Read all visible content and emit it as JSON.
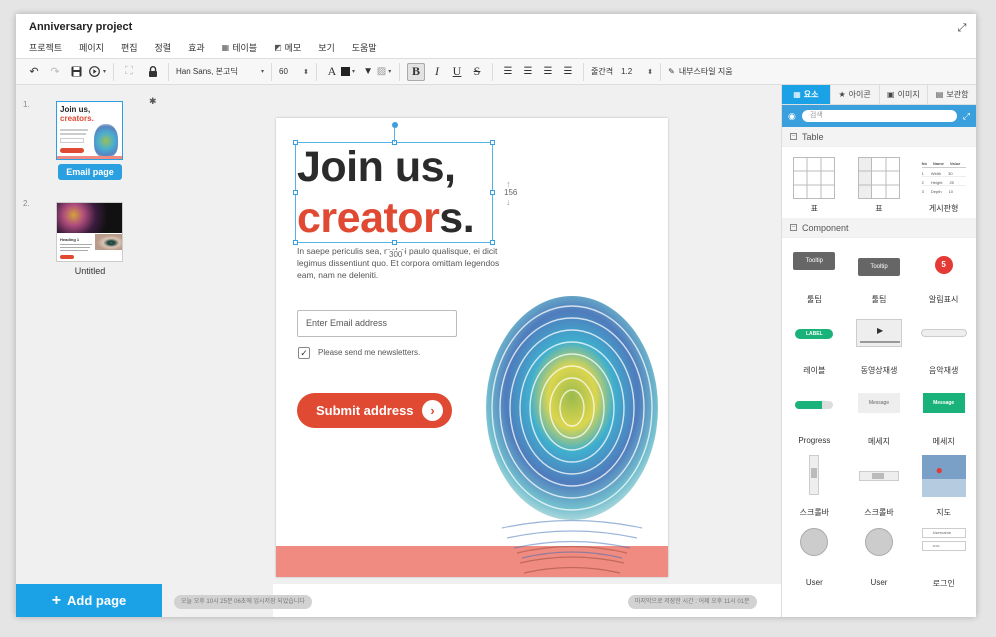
{
  "app": {
    "title": "Anniversary project"
  },
  "menu": [
    {
      "label": "프로젝트",
      "icon": ""
    },
    {
      "label": "페이지",
      "icon": ""
    },
    {
      "label": "편집",
      "icon": ""
    },
    {
      "label": "정렬",
      "icon": ""
    },
    {
      "label": "효과",
      "icon": ""
    },
    {
      "label": "테이블",
      "icon": "table-icon"
    },
    {
      "label": "메모",
      "icon": "memo-icon"
    },
    {
      "label": "보기",
      "icon": ""
    },
    {
      "label": "도움말",
      "icon": ""
    }
  ],
  "toolbar": {
    "font_family": "Han Sans, 본고딕",
    "font_size": "60",
    "line_spacing_label": "줄간격",
    "line_spacing_value": "1.2",
    "clear_style_label": "내부스타일 지움"
  },
  "pages": [
    {
      "number": "1.",
      "label": "Email page",
      "selected": true
    },
    {
      "number": "2.",
      "label": "Untitled",
      "selected": false
    }
  ],
  "add_page_label": "Add page",
  "status": {
    "autosave": "오늘 오후 10시 25분 06초에 임시저장 되었습니다",
    "last_saved": "마지막으로 저장한 시간 : 어제 오후 11시 01분"
  },
  "email_page": {
    "headline_line1": "Join us,",
    "headline_red": "creator",
    "headline_tail": "s.",
    "body": "In saepe periculis sea, mel ei paulo qualisque, ei dicit legimus dissentiunt quo. Et corpora omittam legendos eam, nam ne deleniti.",
    "email_placeholder": "Enter Email address",
    "checkbox_checked": true,
    "checkbox_label": "Please send me newsletters.",
    "submit_label": "Submit address",
    "selection_height": "156",
    "selection_width": "300"
  },
  "thumb1": {
    "headline1": "Join us,",
    "headline_red": "creators.",
    "button": "Submit address"
  },
  "thumb2": {
    "heading": "Heading 1"
  },
  "right_panel": {
    "tabs": [
      {
        "label": "요소",
        "icon": "grid-icon",
        "active": true
      },
      {
        "label": "아이콘",
        "icon": "star-icon",
        "active": false
      },
      {
        "label": "이미지",
        "icon": "image-icon",
        "active": false
      },
      {
        "label": "보관함",
        "icon": "archive-icon",
        "active": false
      }
    ],
    "search_placeholder": "검색",
    "sections": [
      {
        "title": "Table",
        "items": [
          "표",
          "표",
          "게시판형"
        ]
      },
      {
        "title": "Component",
        "items": [
          "툴팁",
          "툴팁",
          "알림표시",
          "레이블",
          "동영상재생",
          "음악재생",
          "Progress",
          "메세지",
          "메세지",
          "스크롤바",
          "스크롤바",
          "지도",
          "User",
          "User",
          "로그인"
        ]
      }
    ],
    "tooltip_text": "Tooltip",
    "notification_count": "5",
    "label_text": "LABEL",
    "message_text": "Message",
    "mini_table": {
      "headers": [
        "No",
        "Name",
        "Value"
      ],
      "rows": [
        [
          "1",
          "Width",
          "30"
        ],
        [
          "2",
          "Height",
          "25"
        ],
        [
          "3",
          "Depth",
          "10"
        ]
      ]
    },
    "login_fields": [
      "Username",
      "•••••"
    ]
  },
  "colors": {
    "accent": "#1ba1e6",
    "brand_red": "#e04a33",
    "footer": "#ef8b80"
  }
}
